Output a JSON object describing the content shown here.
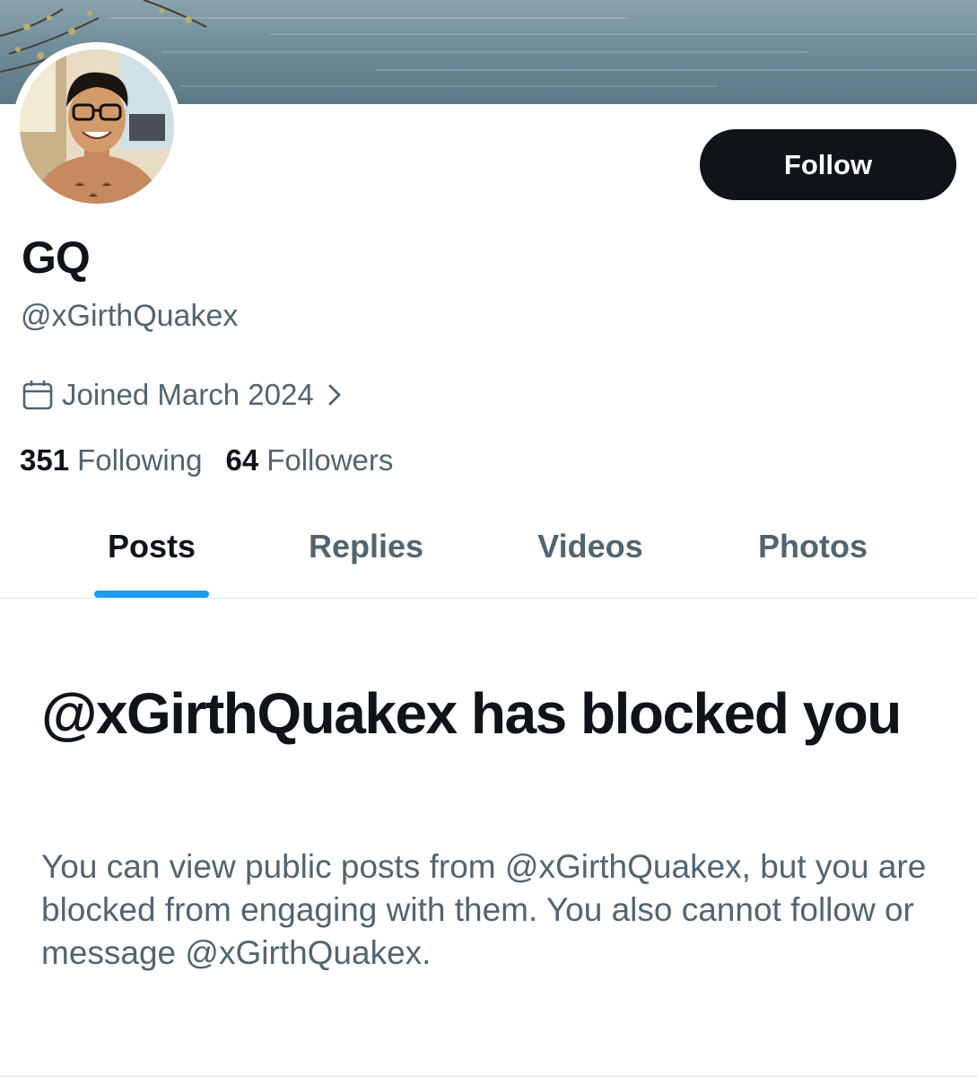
{
  "profile": {
    "display_name": "GQ",
    "handle": "@xGirthQuakex",
    "joined": "Joined March 2024",
    "following_count": "351",
    "following_label": "Following",
    "followers_count": "64",
    "followers_label": "Followers"
  },
  "actions": {
    "follow_label": "Follow"
  },
  "tabs": [
    {
      "label": "Posts",
      "active": true
    },
    {
      "label": "Replies",
      "active": false
    },
    {
      "label": "Videos",
      "active": false
    },
    {
      "label": "Photos",
      "active": false
    }
  ],
  "blocked": {
    "title": "@xGirthQuakex has blocked you",
    "body": "You can view public posts from @xGirthQuakex, but you are blocked from engaging with them. You also cannot follow or message @xGirthQuakex."
  },
  "icons": {
    "calendar": "calendar-icon",
    "chevron": "chevron-right-icon"
  },
  "colors": {
    "primary_text": "#0f1419",
    "secondary_text": "#536471",
    "accent": "#1d9bf0",
    "button_bg": "#0f1419"
  }
}
